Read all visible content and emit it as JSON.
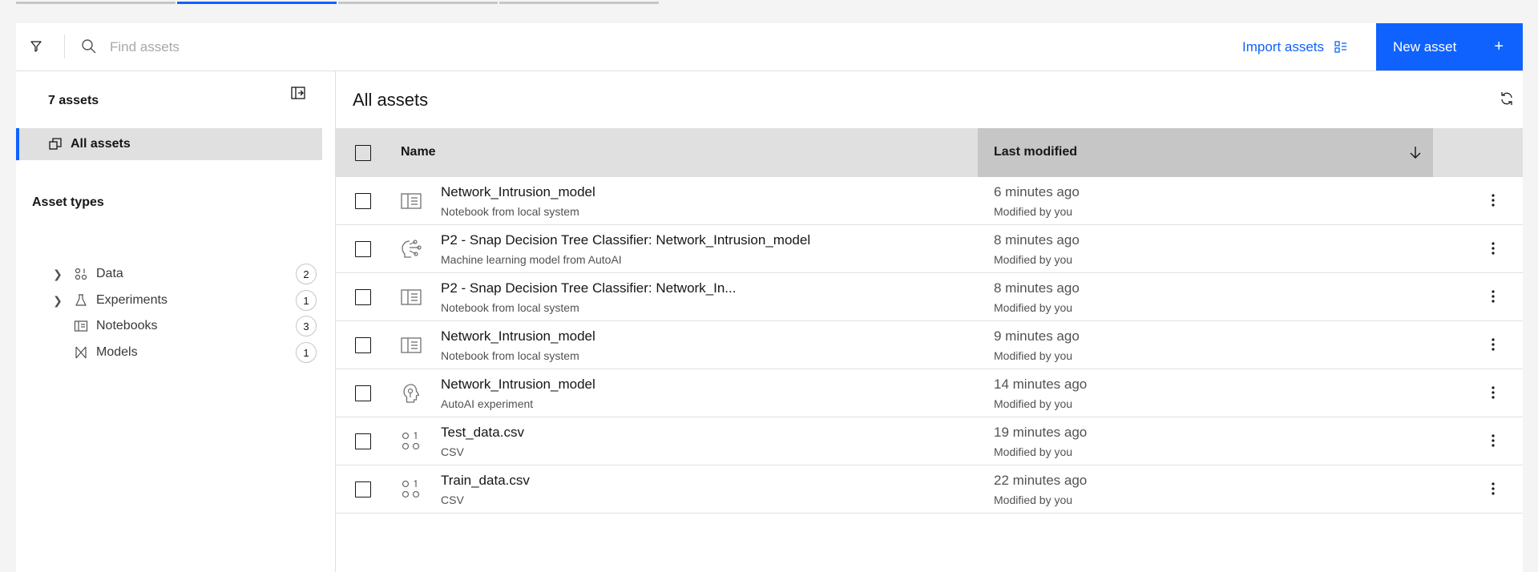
{
  "toolbar": {
    "search_placeholder": "Find assets",
    "import_label": "Import assets",
    "new_asset_label": "New asset",
    "new_asset_plus": "+"
  },
  "sidebar": {
    "asset_count": "7 assets",
    "all_assets_label": "All assets",
    "asset_types_title": "Asset types",
    "types": [
      {
        "label": "Data",
        "count": "2",
        "expandable": true,
        "icon": "data-icon"
      },
      {
        "label": "Experiments",
        "count": "1",
        "expandable": true,
        "icon": "flask-icon"
      },
      {
        "label": "Notebooks",
        "count": "3",
        "expandable": false,
        "icon": "notebook-icon"
      },
      {
        "label": "Models",
        "count": "1",
        "expandable": false,
        "icon": "model-icon"
      }
    ]
  },
  "main": {
    "title": "All assets",
    "table": {
      "headers": {
        "name": "Name",
        "last_modified": "Last modified"
      },
      "rows": [
        {
          "name": "Network_Intrusion_model",
          "subtitle": "Notebook from local system",
          "modified": "6 minutes ago",
          "by": "Modified by you",
          "icon": "notebook-icon"
        },
        {
          "name": "P2 - Snap Decision Tree Classifier: Network_Intrusion_model",
          "subtitle": "Machine learning model from AutoAI",
          "modified": "8 minutes ago",
          "by": "Modified by you",
          "icon": "ml-model-icon"
        },
        {
          "name": "P2 - Snap Decision Tree Classifier: Network_In...",
          "subtitle": "Notebook from local system",
          "modified": "8 minutes ago",
          "by": "Modified by you",
          "icon": "notebook-icon"
        },
        {
          "name": "Network_Intrusion_model",
          "subtitle": "Notebook from local system",
          "modified": "9 minutes ago",
          "by": "Modified by you",
          "icon": "notebook-icon"
        },
        {
          "name": "Network_Intrusion_model",
          "subtitle": "AutoAI experiment",
          "modified": "14 minutes ago",
          "by": "Modified by you",
          "icon": "autoai-icon"
        },
        {
          "name": "Test_data.csv",
          "subtitle": "CSV",
          "modified": "19 minutes ago",
          "by": "Modified by you",
          "icon": "data-icon"
        },
        {
          "name": "Train_data.csv",
          "subtitle": "CSV",
          "modified": "22 minutes ago",
          "by": "Modified by you",
          "icon": "data-icon"
        }
      ]
    }
  },
  "colors": {
    "accent": "#0f62fe",
    "selected_bg": "#e0e0e0",
    "header_sorted_bg": "#c6c6c6"
  }
}
